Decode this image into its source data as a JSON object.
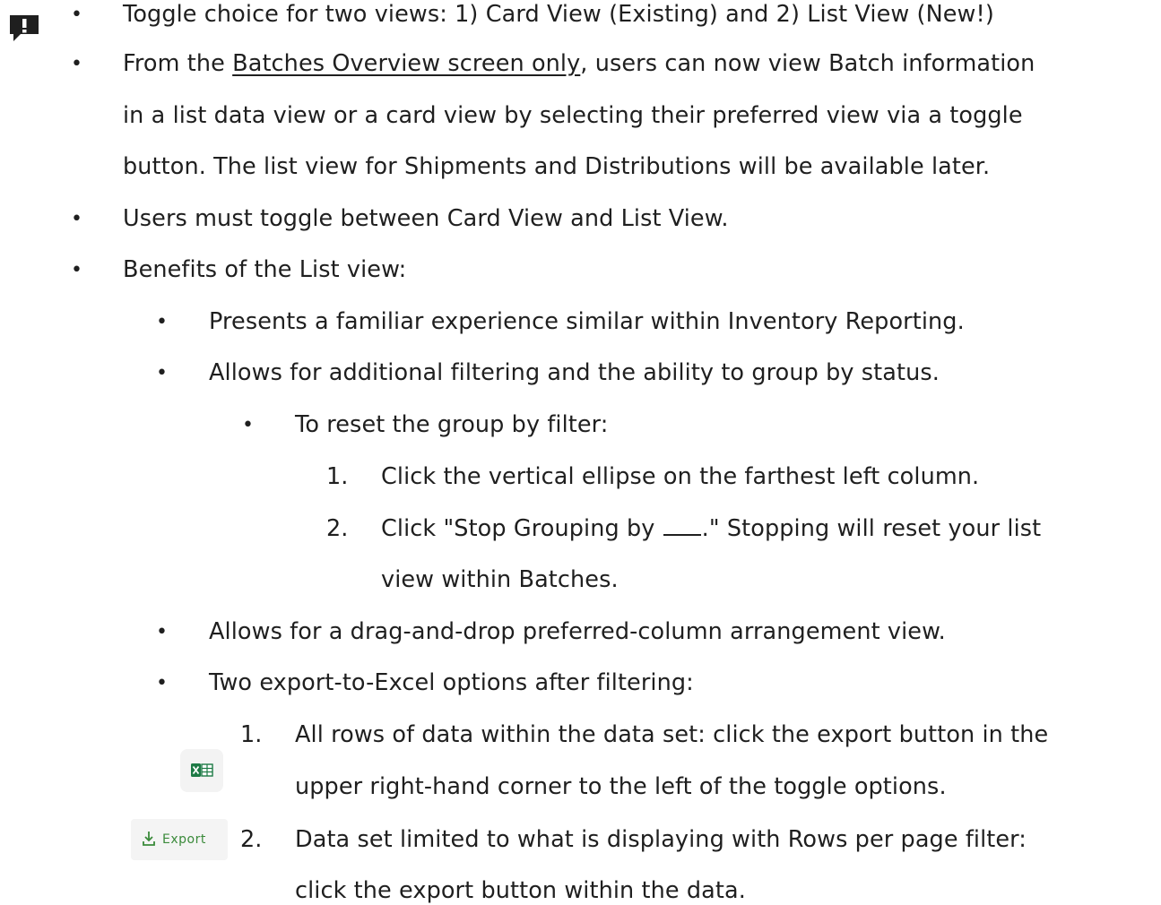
{
  "doc": {
    "lines": [
      {
        "id": "l1",
        "text": "Toggle choice for two views: 1) Card View (Existing) and 2) List View (New!)"
      },
      {
        "id": "l2a_u",
        "text": "Batches Overview screen only"
      },
      {
        "id": "l2a_pre",
        "text": "From the "
      },
      {
        "id": "l2a_post",
        "text": ", users can now view Batch information"
      },
      {
        "id": "l2b",
        "text": "in a list data view or a card view by selecting their preferred view via a toggle"
      },
      {
        "id": "l2c",
        "text": "button. The list view for Shipments and Distributions will be available later."
      },
      {
        "id": "l3",
        "text": "Users must toggle between Card View and List View."
      },
      {
        "id": "l4",
        "text": "Benefits of the List view:"
      },
      {
        "id": "l5",
        "text": "Presents a familiar experience similar within Inventory Reporting."
      },
      {
        "id": "l6",
        "text": "Allows for additional filtering and the ability to group by status."
      },
      {
        "id": "l7",
        "text": "To reset the group by filter:"
      },
      {
        "id": "l8",
        "text": "Click the vertical ellipse on the farthest left column."
      },
      {
        "id": "l9a_pre",
        "text": "Click \"Stop Grouping by "
      },
      {
        "id": "l9a_post",
        "text": ".\" Stopping will reset your list"
      },
      {
        "id": "l9b",
        "text": "view within Batches."
      },
      {
        "id": "l10",
        "text": "Allows for a drag-and-drop preferred-column arrangement view."
      },
      {
        "id": "l11",
        "text": "Two export-to-Excel options after filtering:"
      },
      {
        "id": "l12a",
        "text": "All rows of data within the data set: click the export button in the"
      },
      {
        "id": "l12b",
        "text": "upper right-hand corner to the left of the toggle options."
      },
      {
        "id": "l13a",
        "text": "Data set limited to what is displaying with Rows per page filter:"
      },
      {
        "id": "l13b",
        "text": "click the export button within the data."
      }
    ],
    "numbers": {
      "n1": "1.",
      "n2": "2.",
      "n3": "1.",
      "n4": "2."
    },
    "bullet": "•"
  },
  "export_chip": {
    "label": "Export"
  },
  "icons": {
    "alert": "alert-comment-icon",
    "excel": "excel-icon",
    "download": "download-icon"
  },
  "colors": {
    "text": "#1f1f1f",
    "excel_green": "#1d7a45",
    "export_green": "#3a8a3a"
  }
}
